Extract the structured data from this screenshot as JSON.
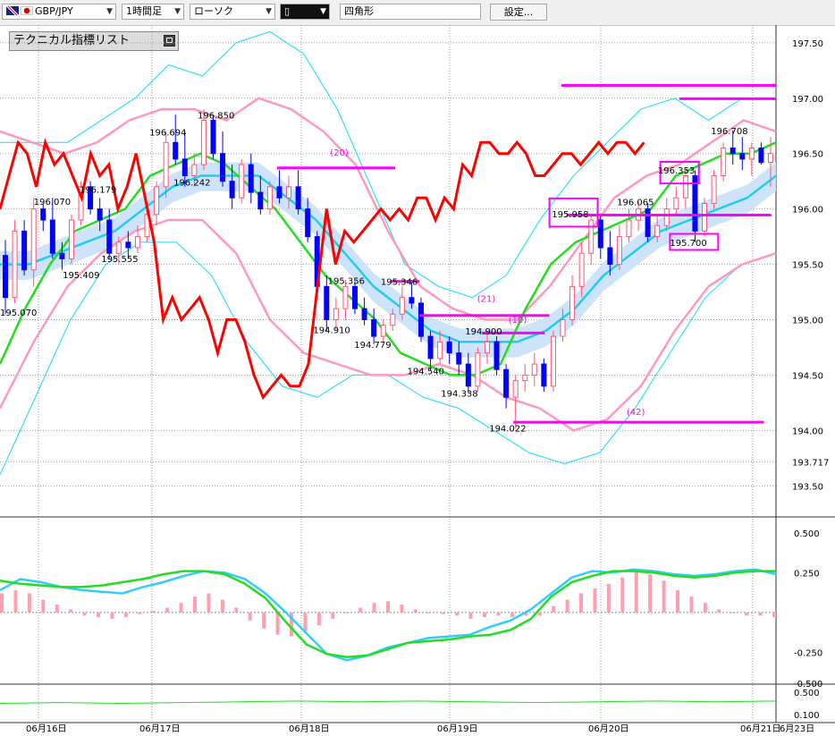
{
  "toolbar": {
    "symbol": "GBP/JPY",
    "timeframe": "1時間足",
    "chart_style": "ローソク",
    "drawing_tool": "四角形",
    "settings_button": "設定..."
  },
  "indicator_panel": {
    "label": "テクニカル指標リスト"
  },
  "colors": {
    "up_candle": "#ff5577",
    "down_candle": "#0000ff",
    "rsi_line": "#ff0000",
    "ma_short": "#22dd22",
    "ma_long": "#22ccee",
    "bollinger_inner": "#ff99bb",
    "bollinger_outer": "#33ddff",
    "cloud_up": "#c8e0f8",
    "cloud_down": "#ffd0e0",
    "lines": "#ff00ff",
    "macd_line": "#33ccff",
    "signal_line": "#22dd22",
    "histogram": "#ff9fb0"
  },
  "chart_data": [
    {
      "type": "candlestick",
      "y_ticks": [
        "197.50",
        "197.00",
        "196.50",
        "196.00",
        "195.50",
        "195.00",
        "194.50",
        "194.00",
        "193.717",
        "193.50"
      ],
      "ylim": [
        193.22,
        197.66
      ],
      "x_date_labels": [
        "06月16日",
        "06月17日",
        "06月18日",
        "06月19日",
        "06月20日",
        "06月21日",
        "6月23日"
      ],
      "price_labels": [
        {
          "text": "196.850",
          "x": 82,
          "price": 196.85
        },
        {
          "text": "196.694",
          "x": 62,
          "price": 196.694
        },
        {
          "text": "196.242",
          "x": 72,
          "price": 196.242
        },
        {
          "text": "196.179",
          "x": 33,
          "price": 196.179
        },
        {
          "text": "196.070",
          "x": 14,
          "price": 196.07
        },
        {
          "text": "195.555",
          "x": 42,
          "price": 195.555
        },
        {
          "text": "195.409",
          "x": 26,
          "price": 195.409
        },
        {
          "text": "195.070",
          "x": 0,
          "price": 195.07
        },
        {
          "text": "195.356",
          "x": 136,
          "price": 195.356
        },
        {
          "text": "195.346",
          "x": 158,
          "price": 195.346
        },
        {
          "text": "194.910",
          "x": 130,
          "price": 194.91
        },
        {
          "text": "194.779",
          "x": 147,
          "price": 194.779
        },
        {
          "text": "194.900",
          "x": 193,
          "price": 194.9
        },
        {
          "text": "194.540",
          "x": 169,
          "price": 194.54
        },
        {
          "text": "194.338",
          "x": 183,
          "price": 194.338
        },
        {
          "text": "194.022",
          "x": 203,
          "price": 194.022
        },
        {
          "text": "195.958",
          "x": 229,
          "price": 195.958
        },
        {
          "text": "196.065",
          "x": 256,
          "price": 196.065
        },
        {
          "text": "196.353",
          "x": 273,
          "price": 196.353
        },
        {
          "text": "195.700",
          "x": 278,
          "price": 195.7
        },
        {
          "text": "196.708",
          "x": 295,
          "price": 196.708
        }
      ],
      "line_labels": [
        {
          "text": "(20)",
          "x": 137,
          "price": 196.48
        },
        {
          "text": "(21)",
          "x": 198,
          "price": 195.16
        },
        {
          "text": "(10)",
          "x": 211,
          "price": 194.97
        },
        {
          "text": "(42)",
          "x": 260,
          "price": 194.14
        }
      ],
      "horizontal_lines": [
        {
          "x_start": 115,
          "x_end": 164,
          "price": 196.37
        },
        {
          "x_start": 162,
          "x_end": 174,
          "price": 195.346
        },
        {
          "x_start": 174,
          "x_end": 228,
          "price": 195.038
        },
        {
          "x_start": 200,
          "x_end": 226,
          "price": 194.88
        },
        {
          "x_start": 213,
          "x_end": 317,
          "price": 194.075
        },
        {
          "x_start": 235,
          "x_end": 320,
          "price": 195.945
        },
        {
          "x_start": 233,
          "x_end": 322,
          "price": 197.115
        },
        {
          "x_start": 282,
          "x_end": 322,
          "price": 196.995
        }
      ],
      "highlight_boxes": [
        {
          "x_start": 228,
          "x_end": 248,
          "price_low": 195.84,
          "price_high": 196.095
        },
        {
          "x_start": 274,
          "x_end": 290,
          "price_low": 196.23,
          "price_high": 196.425
        },
        {
          "x_start": 278,
          "x_end": 298,
          "price_low": 195.63,
          "price_high": 195.775
        }
      ],
      "candles": [
        [
          195.58,
          195.72,
          195.05,
          195.2
        ],
        [
          195.2,
          195.9,
          195.15,
          195.8
        ],
        [
          195.8,
          195.9,
          195.4,
          195.45
        ],
        [
          195.45,
          196.1,
          195.3,
          196.0
        ],
        [
          196.0,
          196.05,
          195.8,
          195.9
        ],
        [
          195.9,
          196.1,
          195.55,
          195.6
        ],
        [
          195.6,
          195.7,
          195.45,
          195.55
        ],
        [
          195.55,
          195.95,
          195.5,
          195.9
        ],
        [
          195.9,
          196.25,
          195.85,
          196.2
        ],
        [
          196.2,
          196.25,
          195.95,
          196.0
        ],
        [
          196.0,
          196.1,
          195.8,
          195.9
        ],
        [
          195.9,
          196.0,
          195.55,
          195.6
        ],
        [
          195.6,
          195.75,
          195.5,
          195.7
        ],
        [
          195.7,
          195.8,
          195.55,
          195.65
        ],
        [
          195.65,
          195.85,
          195.6,
          195.75
        ],
        [
          195.75,
          196.0,
          195.7,
          195.95
        ],
        [
          195.95,
          196.25,
          195.85,
          196.2
        ],
        [
          196.2,
          196.7,
          196.1,
          196.6
        ],
        [
          196.6,
          196.85,
          196.4,
          196.45
        ],
        [
          196.45,
          196.7,
          196.2,
          196.3
        ],
        [
          196.3,
          196.5,
          196.2,
          196.4
        ],
        [
          196.4,
          196.9,
          196.35,
          196.8
        ],
        [
          196.8,
          196.85,
          196.45,
          196.5
        ],
        [
          196.5,
          196.7,
          196.2,
          196.25
        ],
        [
          196.25,
          196.4,
          196.0,
          196.1
        ],
        [
          196.1,
          196.45,
          196.05,
          196.4
        ],
        [
          196.4,
          196.5,
          196.05,
          196.15
        ],
        [
          196.15,
          196.3,
          195.95,
          196.0
        ],
        [
          196.0,
          196.25,
          195.95,
          196.2
        ],
        [
          196.2,
          196.35,
          196.05,
          196.1
        ],
        [
          196.1,
          196.3,
          196.0,
          196.2
        ],
        [
          196.2,
          196.35,
          195.95,
          196.0
        ],
        [
          196.0,
          196.1,
          195.7,
          195.75
        ],
        [
          195.75,
          195.8,
          195.2,
          195.3
        ],
        [
          195.3,
          195.4,
          194.9,
          195.0
        ],
        [
          195.0,
          195.2,
          194.91,
          195.1
        ],
        [
          195.1,
          195.36,
          195.0,
          195.3
        ],
        [
          195.3,
          195.35,
          195.05,
          195.1
        ],
        [
          195.1,
          195.2,
          194.95,
          195.0
        ],
        [
          195.0,
          195.1,
          194.78,
          194.85
        ],
        [
          194.85,
          195.0,
          194.8,
          194.95
        ],
        [
          194.95,
          195.1,
          194.9,
          195.05
        ],
        [
          195.05,
          195.3,
          195.0,
          195.2
        ],
        [
          195.2,
          195.35,
          195.1,
          195.15
        ],
        [
          195.15,
          195.2,
          194.8,
          194.85
        ],
        [
          194.85,
          194.9,
          194.54,
          194.65
        ],
        [
          194.65,
          194.9,
          194.6,
          194.8
        ],
        [
          194.8,
          194.85,
          194.6,
          194.7
        ],
        [
          194.7,
          194.8,
          194.5,
          194.6
        ],
        [
          194.6,
          194.7,
          194.34,
          194.4
        ],
        [
          194.4,
          194.75,
          194.35,
          194.7
        ],
        [
          194.7,
          194.9,
          194.6,
          194.8
        ],
        [
          194.8,
          194.85,
          194.5,
          194.55
        ],
        [
          194.55,
          194.6,
          194.2,
          194.3
        ],
        [
          194.3,
          194.5,
          194.02,
          194.45
        ],
        [
          194.45,
          194.6,
          194.35,
          194.5
        ],
        [
          194.5,
          194.7,
          194.4,
          194.6
        ],
        [
          194.6,
          194.65,
          194.35,
          194.4
        ],
        [
          194.4,
          194.9,
          194.35,
          194.85
        ],
        [
          194.85,
          195.1,
          194.8,
          195.0
        ],
        [
          195.0,
          195.4,
          194.95,
          195.3
        ],
        [
          195.3,
          195.7,
          195.2,
          195.6
        ],
        [
          195.6,
          195.96,
          195.5,
          195.9
        ],
        [
          195.9,
          195.95,
          195.55,
          195.65
        ],
        [
          195.65,
          195.8,
          195.4,
          195.5
        ],
        [
          195.5,
          195.85,
          195.45,
          195.75
        ],
        [
          195.75,
          196.0,
          195.7,
          195.9
        ],
        [
          195.9,
          196.07,
          195.8,
          196.0
        ],
        [
          196.0,
          196.05,
          195.7,
          195.75
        ],
        [
          195.75,
          195.95,
          195.7,
          195.85
        ],
        [
          195.85,
          196.1,
          195.8,
          196.0
        ],
        [
          196.0,
          196.2,
          195.95,
          196.1
        ],
        [
          196.1,
          196.35,
          196.0,
          196.3
        ],
        [
          196.3,
          196.35,
          195.7,
          195.8
        ],
        [
          195.8,
          196.1,
          195.75,
          196.05
        ],
        [
          196.05,
          196.35,
          196.0,
          196.3
        ],
        [
          196.3,
          196.6,
          196.25,
          196.55
        ],
        [
          196.55,
          196.71,
          196.4,
          196.5
        ],
        [
          196.5,
          196.65,
          196.35,
          196.45
        ],
        [
          196.45,
          196.6,
          196.3,
          196.55
        ],
        [
          196.55,
          196.6,
          196.4,
          196.42
        ],
        [
          196.42,
          196.65,
          196.2,
          196.5
        ]
      ],
      "series": [
        {
          "name": "rsi",
          "values": [
            196.0,
            196.3,
            196.6,
            196.5,
            196.2,
            196.6,
            196.4,
            196.5,
            196.3,
            196.1,
            196.5,
            196.3,
            196.4,
            196.0,
            196.2,
            196.5,
            196.1,
            195.7,
            195.0,
            195.2,
            195.0,
            195.1,
            195.2,
            195.0,
            194.7,
            195.0,
            195.0,
            194.8,
            194.5,
            194.3,
            194.4,
            194.5,
            194.4,
            194.4,
            194.6,
            195.3,
            196.0,
            195.5,
            195.8,
            195.7,
            195.8,
            195.9,
            196.0,
            195.9,
            196.0,
            195.9,
            196.1,
            196.1,
            195.9,
            196.1,
            196.0,
            196.4,
            196.3,
            196.6,
            196.6,
            196.5,
            196.5,
            196.6,
            196.5,
            196.3,
            196.3,
            196.4,
            196.5,
            196.5,
            196.4,
            196.5,
            196.6,
            196.5,
            196.6,
            196.6,
            196.5,
            196.6
          ]
        },
        {
          "name": "ma_short",
          "values": [
            194.6,
            195.1,
            195.5,
            195.8,
            195.9,
            196.0,
            196.3,
            196.4,
            196.5,
            196.4,
            196.2,
            196.0,
            195.7,
            195.4,
            195.2,
            195.0,
            194.7,
            194.6,
            194.5,
            194.5,
            194.6,
            195.1,
            195.5,
            195.7,
            195.8,
            195.9,
            196.0,
            196.3,
            196.4,
            196.5,
            196.5,
            196.6
          ]
        },
        {
          "name": "ma_long",
          "values": [
            195.5,
            195.5,
            195.6,
            195.7,
            195.8,
            196.0,
            196.2,
            196.3,
            196.3,
            196.3,
            196.1,
            195.9,
            195.6,
            195.3,
            195.1,
            194.9,
            194.8,
            194.8,
            194.8,
            194.9,
            195.1,
            195.4,
            195.6,
            195.8,
            195.9,
            196.0,
            196.1,
            196.3
          ]
        },
        {
          "name": "bollinger_upper_1",
          "values": [
            196.7,
            196.6,
            196.5,
            196.6,
            196.8,
            196.9,
            196.9,
            196.8,
            197.0,
            196.9,
            196.7,
            196.4,
            195.8,
            195.3,
            195.1,
            195.0,
            195.0,
            195.3,
            195.7,
            196.1,
            196.3,
            196.4,
            196.6,
            196.8,
            196.7
          ]
        },
        {
          "name": "bollinger_lower_1",
          "values": [
            194.2,
            194.8,
            195.3,
            195.6,
            195.8,
            195.9,
            195.9,
            195.6,
            195.0,
            194.7,
            194.6,
            194.5,
            194.5,
            194.6,
            194.5,
            194.3,
            194.2,
            194.0,
            194.1,
            194.4,
            194.9,
            195.3,
            195.5,
            195.6
          ]
        },
        {
          "name": "bollinger_upper_2",
          "values": [
            196.6,
            196.6,
            196.6,
            196.8,
            197.0,
            197.3,
            197.2,
            197.5,
            197.6,
            197.4,
            196.9,
            196.2,
            195.5,
            195.3,
            195.2,
            195.4,
            195.9,
            196.3,
            196.6,
            196.9,
            197.0,
            196.8,
            197.0,
            197.0
          ]
        },
        {
          "name": "bollinger_lower_2",
          "values": [
            193.6,
            194.3,
            195.0,
            195.5,
            195.7,
            195.7,
            195.4,
            194.8,
            194.4,
            194.3,
            194.5,
            194.5,
            194.3,
            194.2,
            194.0,
            193.8,
            193.7,
            193.8,
            194.2,
            194.7,
            195.2,
            195.5,
            195.6
          ]
        }
      ]
    },
    {
      "type": "macd",
      "y_ticks": [
        "0.500",
        "0.250",
        "-0.250"
      ],
      "ylim": [
        -0.45,
        0.6
      ],
      "macd": [
        0.14,
        0.21,
        0.19,
        0.16,
        0.14,
        0.13,
        0.12,
        0.16,
        0.19,
        0.23,
        0.26,
        0.25,
        0.21,
        0.12,
        0.0,
        -0.13,
        -0.26,
        -0.3,
        -0.27,
        -0.22,
        -0.19,
        -0.16,
        -0.15,
        -0.14,
        -0.09,
        -0.05,
        0.02,
        0.12,
        0.22,
        0.26,
        0.25,
        0.27,
        0.26,
        0.24,
        0.23,
        0.24,
        0.26,
        0.27,
        0.24
      ],
      "signal": [
        0.2,
        0.18,
        0.17,
        0.16,
        0.16,
        0.17,
        0.19,
        0.21,
        0.24,
        0.26,
        0.26,
        0.24,
        0.18,
        0.09,
        -0.06,
        -0.2,
        -0.26,
        -0.28,
        -0.27,
        -0.23,
        -0.19,
        -0.18,
        -0.17,
        -0.15,
        -0.14,
        -0.11,
        -0.04,
        0.1,
        0.19,
        0.23,
        0.26,
        0.26,
        0.25,
        0.23,
        0.22,
        0.23,
        0.25,
        0.26,
        0.26
      ],
      "histogram": [
        0.12,
        0.14,
        0.12,
        0.08,
        0.05,
        0.02,
        -0.02,
        -0.03,
        -0.04,
        -0.03,
        -0.01,
        0.01,
        0.03,
        0.06,
        0.1,
        0.12,
        0.08,
        0.03,
        -0.05,
        -0.1,
        -0.14,
        -0.15,
        -0.12,
        -0.08,
        -0.04,
        0.0,
        0.03,
        0.06,
        0.07,
        0.05,
        0.02,
        0.0,
        -0.01,
        -0.02,
        -0.04,
        -0.03,
        -0.02,
        -0.03,
        -0.02,
        -0.02,
        0.04,
        0.08,
        0.12,
        0.15,
        0.18,
        0.22,
        0.26,
        0.24,
        0.2,
        0.14,
        0.1,
        0.06,
        0.02,
        0.0,
        -0.02,
        -0.02,
        -0.03
      ]
    },
    {
      "type": "line",
      "y_ticks": [
        "-0.500",
        "0.500",
        "0.100"
      ],
      "ylim": [
        0.05,
        0.55
      ],
      "series": [
        {
          "values": [
            0.3,
            0.31,
            0.3,
            0.31,
            0.32,
            0.33,
            0.32,
            0.33,
            0.32,
            0.31,
            0.32,
            0.33,
            0.32,
            0.33
          ]
        }
      ]
    }
  ]
}
